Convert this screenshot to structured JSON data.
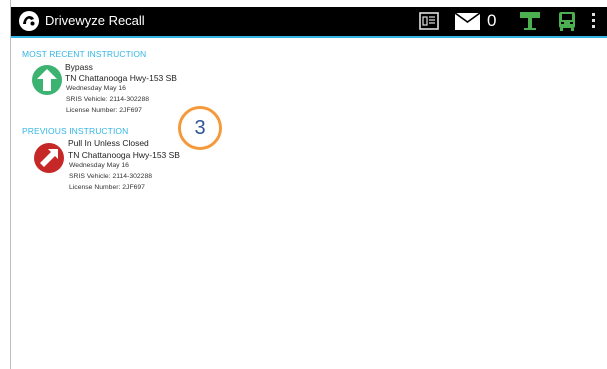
{
  "app": {
    "title": "Drivewyze Recall",
    "logo_icon": "drivewyze-logo-icon"
  },
  "actionbar": {
    "card_icon": "id-card-icon",
    "message_icon": "envelope-icon",
    "message_count": "0",
    "signal_icon": "roadside-signal-icon",
    "truck_icon": "truck-icon",
    "overflow_icon": "overflow-menu-icon",
    "status_color": "#4caf50"
  },
  "colors": {
    "accent": "#33b5e5",
    "bypass": "#3cb371",
    "pull_in": "#c62828",
    "callout_border": "#f39a3c",
    "callout_text": "#2f5496"
  },
  "recent": {
    "header": "MOST RECENT INSTRUCTION",
    "icon": "up-arrow-icon",
    "action": "Bypass",
    "site": "TN Chattanooga Hwy-153 SB",
    "date": "Wednesday May 16",
    "vehicle": "SRIS Vehicle: 2114-302288",
    "license": "License Number: 2JF697"
  },
  "previous": {
    "header": "PREVIOUS INSTRUCTION",
    "icon": "pull-in-arrow-icon",
    "action": "Pull In Unless Closed",
    "site": "TN Chattanooga Hwy-153 SB",
    "date": "Wednesday May 16",
    "vehicle": "SRIS Vehicle: 2114-302288",
    "license": "License Number: 2JF697"
  },
  "callout": {
    "number": "3"
  }
}
